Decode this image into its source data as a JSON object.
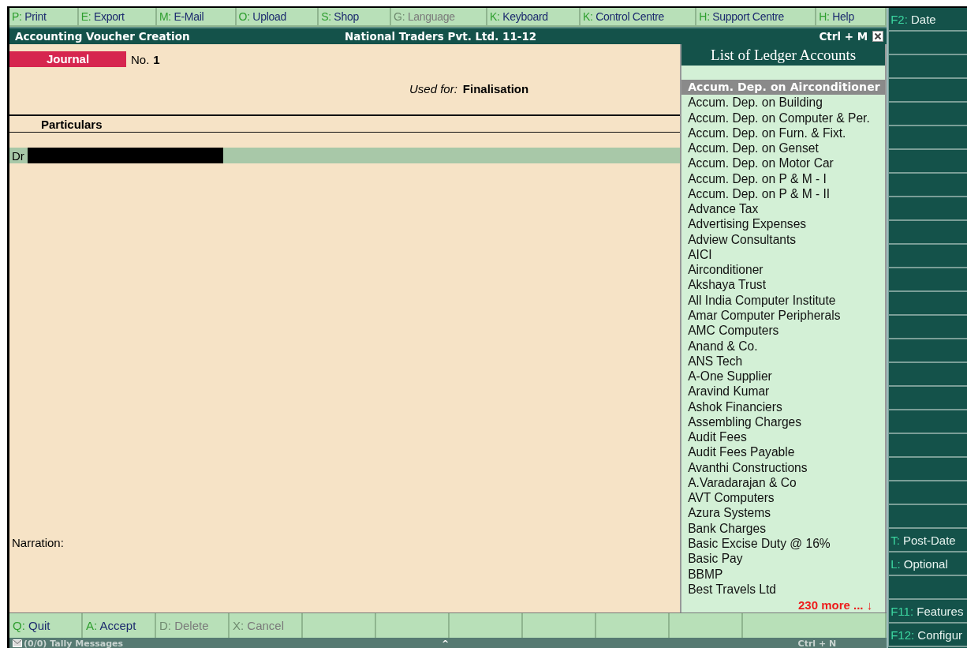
{
  "menu_bar": [
    {
      "key": "P:",
      "label": "Print",
      "disabled": false
    },
    {
      "key": "E:",
      "label": "Export",
      "disabled": false
    },
    {
      "key": "M:",
      "label": "E-Mail",
      "disabled": false
    },
    {
      "key": "O:",
      "label": "Upload",
      "disabled": false
    },
    {
      "key": "S:",
      "label": "Shop",
      "disabled": false
    },
    {
      "key": "G:",
      "label": "Language",
      "disabled": true
    },
    {
      "key": "K:",
      "label": "Keyboard",
      "disabled": false
    },
    {
      "key": "K:",
      "label": "Control Centre",
      "disabled": false
    },
    {
      "key": "H:",
      "label": "Support Centre",
      "disabled": false
    },
    {
      "key": "H:",
      "label": "Help",
      "disabled": false
    }
  ],
  "title_bar": {
    "title": "Accounting Voucher  Creation",
    "company": "National Traders Pvt. Ltd. 11-12",
    "shortcut": "Ctrl + M"
  },
  "voucher": {
    "type": "Journal",
    "number_label": "No.",
    "number": "1",
    "used_for_label": "Used for:",
    "used_for": "Finalisation",
    "column_heading": "Particulars",
    "entry_side": "Dr",
    "narration_label": "Narration:"
  },
  "ledger_list": {
    "title": "List of Ledger Accounts",
    "items": [
      {
        "name": "Accum. Dep. on Airconditioner",
        "selected": true
      },
      {
        "name": "Accum. Dep. on Building",
        "selected": false
      },
      {
        "name": "Accum. Dep. on Computer & Per.",
        "selected": false
      },
      {
        "name": "Accum. Dep. on Furn. & Fixt.",
        "selected": false
      },
      {
        "name": "Accum. Dep. on Genset",
        "selected": false
      },
      {
        "name": "Accum. Dep. on Motor Car",
        "selected": false
      },
      {
        "name": "Accum. Dep. on P & M - I",
        "selected": false
      },
      {
        "name": "Accum. Dep. on P & M - II",
        "selected": false
      },
      {
        "name": "Advance Tax",
        "selected": false
      },
      {
        "name": "Advertising Expenses",
        "selected": false
      },
      {
        "name": "Adview Consultants",
        "selected": false
      },
      {
        "name": "AICI",
        "selected": false
      },
      {
        "name": "Airconditioner",
        "selected": false
      },
      {
        "name": "Akshaya Trust",
        "selected": false
      },
      {
        "name": "All India Computer Institute",
        "selected": false
      },
      {
        "name": "Amar Computer Peripherals",
        "selected": false
      },
      {
        "name": "AMC Computers",
        "selected": false
      },
      {
        "name": "Anand & Co.",
        "selected": false
      },
      {
        "name": "ANS Tech",
        "selected": false
      },
      {
        "name": "A-One Supplier",
        "selected": false
      },
      {
        "name": "Aravind Kumar",
        "selected": false
      },
      {
        "name": "Ashok Financiers",
        "selected": false
      },
      {
        "name": "Assembling Charges",
        "selected": false
      },
      {
        "name": "Audit Fees",
        "selected": false
      },
      {
        "name": "Audit Fees Payable",
        "selected": false
      },
      {
        "name": "Avanthi Constructions",
        "selected": false
      },
      {
        "name": "A.Varadarajan & Co",
        "selected": false
      },
      {
        "name": "AVT Computers",
        "selected": false
      },
      {
        "name": "Azura Systems",
        "selected": false
      },
      {
        "name": "Bank Charges",
        "selected": false
      },
      {
        "name": "Basic Excise Duty @ 16%",
        "selected": false
      },
      {
        "name": "Basic Pay",
        "selected": false
      },
      {
        "name": "BBMP",
        "selected": false
      },
      {
        "name": "Best Travels Ltd",
        "selected": false
      }
    ],
    "more": "230 more ... ↓"
  },
  "bottom_bar": [
    {
      "kind": "button",
      "key": "Q:",
      "label": "Quit",
      "disabled": false
    },
    {
      "kind": "button",
      "key": "A:",
      "label": "Accept",
      "disabled": false
    },
    {
      "kind": "button",
      "key": "D:",
      "label": "Delete",
      "disabled": true
    },
    {
      "kind": "button",
      "key": "X:",
      "label": "Cancel",
      "disabled": true
    },
    {
      "kind": "blank"
    },
    {
      "kind": "blank"
    },
    {
      "kind": "blank"
    },
    {
      "kind": "blank"
    },
    {
      "kind": "blank"
    },
    {
      "kind": "blank"
    },
    {
      "kind": "blank"
    }
  ],
  "status_bar": {
    "messages": "(0/0) Tally Messages",
    "caret": "^",
    "shortcut": "Ctrl + N"
  },
  "side_buttons": [
    {
      "kind": "fkey",
      "key": "F2:",
      "label": "Date"
    },
    {
      "kind": "blank"
    },
    {
      "kind": "blank"
    },
    {
      "kind": "blank"
    },
    {
      "kind": "blank"
    },
    {
      "kind": "blank"
    },
    {
      "kind": "blank"
    },
    {
      "kind": "blank"
    },
    {
      "kind": "blank"
    },
    {
      "kind": "blank"
    },
    {
      "kind": "blank"
    },
    {
      "kind": "blank"
    },
    {
      "kind": "blank"
    },
    {
      "kind": "blank"
    },
    {
      "kind": "blank"
    },
    {
      "kind": "blank"
    },
    {
      "kind": "blank"
    },
    {
      "kind": "blank"
    },
    {
      "kind": "blank"
    },
    {
      "kind": "blank"
    },
    {
      "kind": "blank"
    },
    {
      "kind": "blank"
    },
    {
      "kind": "letter",
      "key": "T:",
      "label": "Post-Date"
    },
    {
      "kind": "letter",
      "key": "L:",
      "label": "Optional"
    },
    {
      "kind": "blank"
    },
    {
      "kind": "fkey",
      "key": "F11:",
      "label": "Features"
    },
    {
      "kind": "fkey",
      "key": "F12:",
      "label": "Configur"
    }
  ]
}
